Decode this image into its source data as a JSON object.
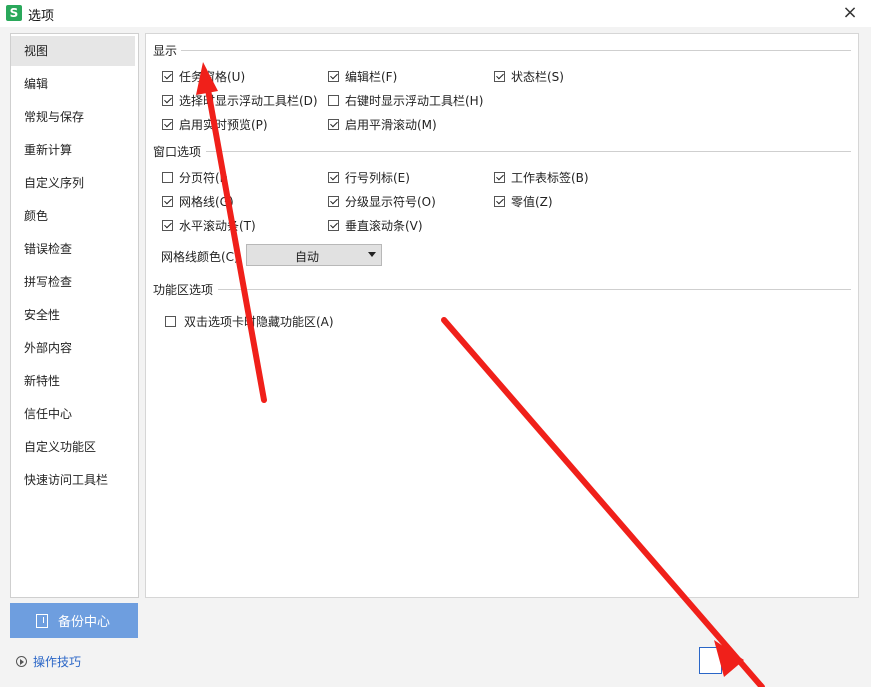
{
  "window": {
    "title": "选项",
    "icon_letter": "S",
    "icon": "wps-app-icon",
    "close_label": "×"
  },
  "nav": {
    "items": [
      "视图",
      "编辑",
      "常规与保存",
      "重新计算",
      "自定义序列",
      "颜色",
      "错误检查",
      "拼写检查",
      "安全性",
      "外部内容",
      "新特性",
      "信任中心",
      "自定义功能区",
      "快速访问工具栏"
    ],
    "active_index": 0
  },
  "display": {
    "title": "显示",
    "task_pane": {
      "label": "任务窗格(U)",
      "checked": true
    },
    "formula_bar": {
      "label": "编辑栏(F)",
      "checked": true
    },
    "status_bar": {
      "label": "状态栏(S)",
      "checked": true
    },
    "float_toolbar_select": {
      "label": "选择时显示浮动工具栏(D)",
      "checked": true
    },
    "float_toolbar_rclick": {
      "label": "右键时显示浮动工具栏(H)",
      "checked": false
    },
    "live_preview": {
      "label": "启用实时预览(P)",
      "checked": true
    },
    "smooth_scroll": {
      "label": "启用平滑滚动(M)",
      "checked": true
    }
  },
  "window_options": {
    "title": "窗口选项",
    "page_break": {
      "label": "分页符(I)",
      "checked": false
    },
    "row_col_headers": {
      "label": "行号列标(E)",
      "checked": true
    },
    "sheet_tabs": {
      "label": "工作表标签(B)",
      "checked": true
    },
    "gridlines": {
      "label": "网格线(G)",
      "checked": true
    },
    "outline_symbols": {
      "label": "分级显示符号(O)",
      "checked": true
    },
    "zero_values": {
      "label": "零值(Z)",
      "checked": true
    },
    "h_scroll": {
      "label": "水平滚动条(T)",
      "checked": true
    },
    "v_scroll": {
      "label": "垂直滚动条(V)",
      "checked": true
    },
    "grid_color_label": "网格线颜色(C)",
    "grid_color_value": "自动"
  },
  "ribbon": {
    "title": "功能区选项",
    "hide_on_double_click": {
      "label": "双击选项卡时隐藏功能区(A)",
      "checked": false
    }
  },
  "footer": {
    "backup_label": "备份中心",
    "tips_label": "操作技巧"
  },
  "colors": {
    "backup_bg": "#6e9edf",
    "link": "#2a66c7",
    "annotation_arrow": "#f0201a"
  }
}
